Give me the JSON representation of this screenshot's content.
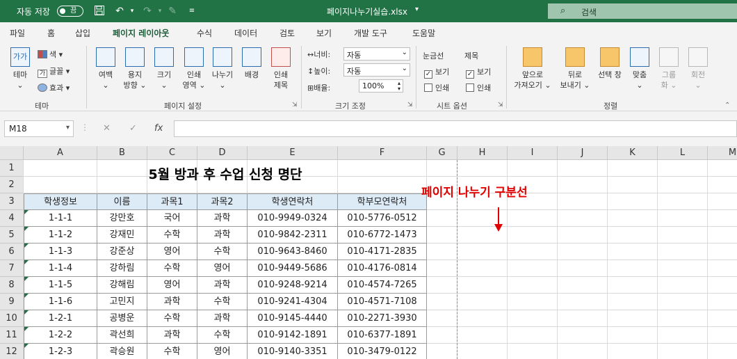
{
  "titlebar": {
    "autosave_label": "자동 저장",
    "autosave_toggle": "끔",
    "filename": "페이지나누기실습.xlsx",
    "filename_caret": "▾",
    "search_placeholder": "검색"
  },
  "menu_tabs": [
    "파일",
    "홈",
    "삽입",
    "페이지 레이아웃",
    "수식",
    "데이터",
    "검토",
    "보기",
    "개발 도구",
    "도움말"
  ],
  "active_tab": "페이지 레이아웃",
  "ribbon": {
    "theme": {
      "theme_btn": "테마",
      "colors": "색 ▾",
      "fonts": "글꼴 ▾",
      "effects": "효과 ▾",
      "group_label": "테마"
    },
    "page_setup": {
      "margins": [
        "여백",
        "⌄"
      ],
      "orientation": [
        "용지",
        "방향 ⌄"
      ],
      "size": [
        "크기",
        "⌄"
      ],
      "print_area": [
        "인쇄",
        "영역 ⌄"
      ],
      "breaks": [
        "나누기",
        "⌄"
      ],
      "background": [
        "배경"
      ],
      "print_titles": [
        "인쇄",
        "제목"
      ],
      "group_label": "페이지 설정"
    },
    "scale": {
      "width_label": "너비:",
      "width_value": "자동",
      "height_label": "높이:",
      "height_value": "자동",
      "scale_label": "배율:",
      "scale_value": "100%",
      "group_label": "크기 조정"
    },
    "sheet_options": {
      "gridlines_header": "눈금선",
      "headings_header": "제목",
      "view": "보기",
      "print": "인쇄",
      "group_label": "시트 옵션"
    },
    "arrange": {
      "bring_forward": [
        "앞으로",
        "가져오기 ⌄"
      ],
      "send_backward": [
        "뒤로",
        "보내기 ⌄"
      ],
      "selection_pane": [
        "선택 창"
      ],
      "align": [
        "맞춤",
        "⌄"
      ],
      "group": [
        "그룹",
        "화 ⌄"
      ],
      "rotate": [
        "회전",
        "⌄"
      ],
      "group_label": "정렬"
    }
  },
  "formula_bar": {
    "name_box": "M18",
    "cancel": "✕",
    "enter": "✓",
    "fx": "fx",
    "formula": ""
  },
  "sheet": {
    "columns": [
      "A",
      "B",
      "C",
      "D",
      "E",
      "F",
      "G",
      "H",
      "I",
      "J",
      "K",
      "L",
      "M"
    ],
    "rows": [
      "1",
      "2",
      "3",
      "4",
      "5",
      "6",
      "7",
      "8",
      "9",
      "10",
      "11",
      "12"
    ],
    "title": "5월 방과 후 수업 신청 명단",
    "table_headers": [
      "학생정보",
      "이름",
      "과목1",
      "과목2",
      "학생연락처",
      "학부모연락처"
    ],
    "table_rows": [
      [
        "1-1-1",
        "강만호",
        "국어",
        "과학",
        "010-9949-0324",
        "010-5776-0512"
      ],
      [
        "1-1-2",
        "강재민",
        "수학",
        "과학",
        "010-9842-2311",
        "010-6772-1473"
      ],
      [
        "1-1-3",
        "강준상",
        "영어",
        "수학",
        "010-9643-8460",
        "010-4171-2835"
      ],
      [
        "1-1-4",
        "강하림",
        "수학",
        "영어",
        "010-9449-5686",
        "010-4176-0814"
      ],
      [
        "1-1-5",
        "강해림",
        "영어",
        "과학",
        "010-9248-9214",
        "010-4574-7265"
      ],
      [
        "1-1-6",
        "고민지",
        "과학",
        "수학",
        "010-9241-4304",
        "010-4571-7108"
      ],
      [
        "1-2-1",
        "공병운",
        "수학",
        "과학",
        "010-9145-4440",
        "010-2271-3930"
      ],
      [
        "1-2-2",
        "곽선희",
        "과학",
        "수학",
        "010-9142-1891",
        "010-6377-1891"
      ],
      [
        "1-2-3",
        "곽승원",
        "수학",
        "영어",
        "010-9140-3351",
        "010-3479-0122"
      ]
    ]
  },
  "annotation": {
    "text": "페이지 나누기 구분선",
    "color": "#e00000"
  },
  "colors": {
    "brand": "#217346",
    "table_header_fill": "#ddebf7"
  }
}
